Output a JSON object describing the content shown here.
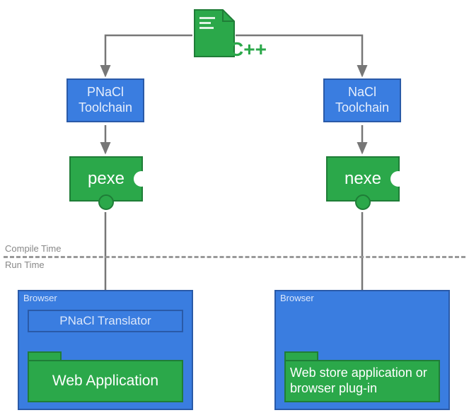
{
  "source": {
    "language_label": "C++"
  },
  "phases": {
    "compile": "Compile Time",
    "run": "Run Time"
  },
  "left": {
    "toolchain": "PNaCl Toolchain",
    "artifact": "pexe",
    "browser_label": "Browser",
    "translator": "PNaCl Translator",
    "app": "Web Application"
  },
  "right": {
    "toolchain": "NaCl Toolchain",
    "artifact": "nexe",
    "browser_label": "Browser",
    "app": "Web store application or browser plug-in"
  }
}
